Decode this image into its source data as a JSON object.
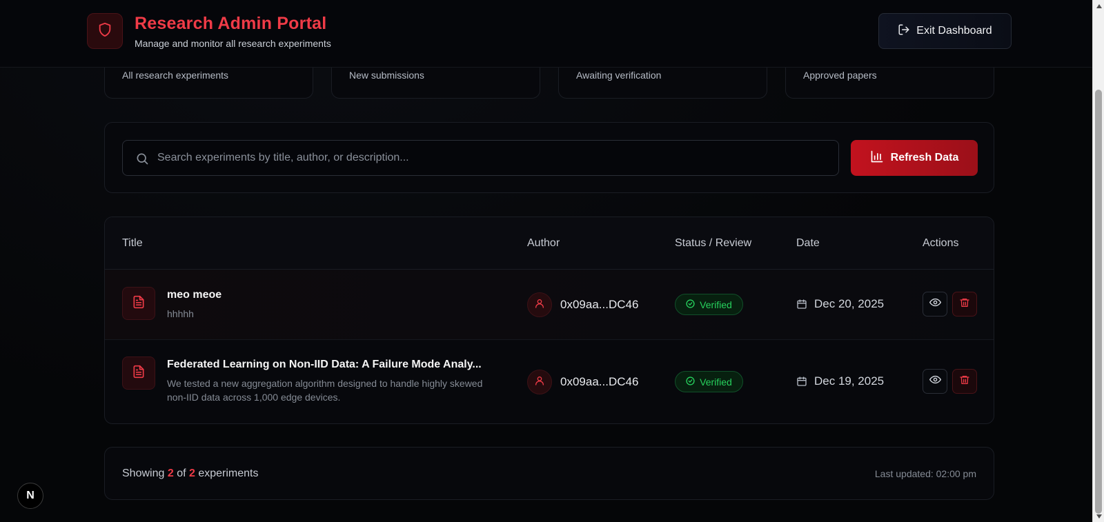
{
  "header": {
    "title": "Research Admin Portal",
    "subtitle": "Manage and monitor all research experiments",
    "exit_label": "Exit Dashboard"
  },
  "stats": [
    {
      "label": "All research experiments"
    },
    {
      "label": "New submissions"
    },
    {
      "label": "Awaiting verification"
    },
    {
      "label": "Approved papers"
    }
  ],
  "search": {
    "placeholder": "Search experiments by title, author, or description...",
    "value": "",
    "refresh_label": "Refresh Data"
  },
  "table": {
    "columns": [
      "Title",
      "Author",
      "Status / Review",
      "Date",
      "Actions"
    ],
    "rows": [
      {
        "title": "meo meoe",
        "description": "hhhhh",
        "author": "0x09aa...DC46",
        "status": "Verified",
        "date": "Dec 20, 2025"
      },
      {
        "title": "Federated Learning on Non-IID Data: A Failure Mode Analy...",
        "description": "We tested a new aggregation algorithm designed to handle highly skewed non-IID data across 1,000 edge devices.",
        "author": "0x09aa...DC46",
        "status": "Verified",
        "date": "Dec 19, 2025"
      }
    ]
  },
  "footer": {
    "showing_prefix": "Showing",
    "shown_count": "2",
    "of_word": "of",
    "total_count": "2",
    "suffix": "experiments",
    "last_updated": "Last updated: 02:00 pm"
  },
  "badge": {
    "letter": "N"
  },
  "colors": {
    "accent": "#ef3b47",
    "verified": "#27d15d",
    "background": "#050608"
  },
  "icons": {
    "logo": "shield-icon",
    "exit": "log-out-icon",
    "search": "search-icon",
    "refresh": "bar-chart-icon",
    "document": "file-text-icon",
    "author": "user-icon",
    "status": "check-circle-icon",
    "date": "calendar-icon",
    "view": "eye-icon",
    "delete": "trash-icon"
  }
}
